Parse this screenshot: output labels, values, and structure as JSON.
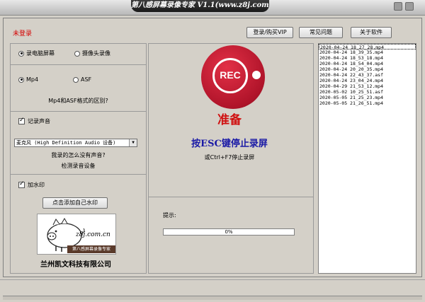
{
  "window": {
    "title": "第八感屏幕录像专家 V1.1(www.z8j.com.cn)"
  },
  "header": {
    "login_status": "未登录",
    "buttons": {
      "login_vip": "登录/购买VIP",
      "faq": "常见问题",
      "about": "关于软件"
    }
  },
  "left_panel": {
    "source": {
      "screen_label": "录电脑屏幕",
      "camera_label": "摄像头录像",
      "selected": "screen"
    },
    "format": {
      "mp4_label": "Mp4",
      "asf_label": "ASF",
      "selected": "mp4",
      "diff_link": "Mp4和ASF格式的区别?"
    },
    "audio": {
      "record_label": "记录声音",
      "record_checked": true,
      "device_value": "麦克风 (High Definition Audio 设备)",
      "no_sound_link": "我录的怎么没有声音?",
      "detect_link": "检测录音设备"
    },
    "watermark": {
      "label": "加水印",
      "checked": true,
      "add_button": "点击添加自己水印",
      "logo_url_text": "z8j.com.cn",
      "logo_caption": "第八感屏幕录像专家"
    },
    "company": "兰州凯文科技有限公司"
  },
  "center_panel": {
    "rec_label": "REC",
    "status": "准备",
    "esc_instruction": "按ESC键停止录屏",
    "ctrl_instruction": "或Ctrl+F7停止录屏",
    "hint_label": "提示:",
    "progress": {
      "value": 0,
      "text": "0%"
    }
  },
  "file_list": {
    "items": [
      "2020-04-24 18_27_28.mp4",
      "2020-04-24 18_39_35.mp4",
      "2020-04-24 18_53_18.mp4",
      "2020-04-24 18_54_04.mp4",
      "2020-04-24 20_20_35.mp4",
      "2020-04-24 22_43_37.asf",
      "2020-04-24 23_04_24.mp4",
      "2020-04-29 21_53_12.mp4",
      "2020-05-02 10_25_51.asf",
      "2020-05-05 21_25_23.mp4",
      "2020-05-05 21_26_51.mp4"
    ]
  },
  "colors": {
    "rec_red": "#c41a30",
    "status_red": "#d01010",
    "instruction_blue": "#1a1aa6",
    "login_red": "#d40000"
  }
}
